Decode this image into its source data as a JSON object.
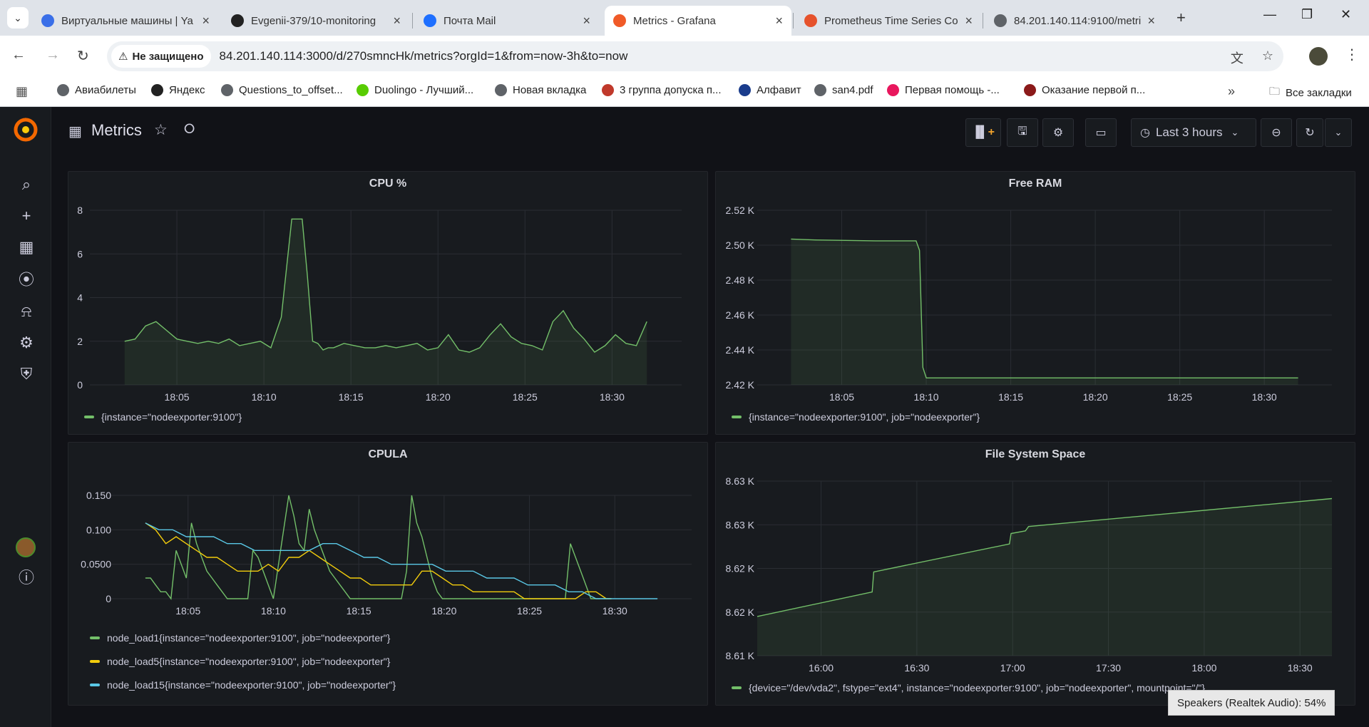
{
  "browser": {
    "tabs": [
      {
        "label": "Виртуальные машины | Ya",
        "icon": "yandex-cloud-icon",
        "color": "#3a6fe8"
      },
      {
        "label": "Evgenii-379/10-monitoring",
        "icon": "github-icon",
        "color": "#222222"
      },
      {
        "label": "Почта Mail",
        "icon": "mail-icon",
        "color": "#1e6fff"
      },
      {
        "label": "Metrics - Grafana",
        "icon": "grafana-icon",
        "color": "#f05a28"
      },
      {
        "label": "Prometheus Time Series Co",
        "icon": "prometheus-icon",
        "color": "#e6522c"
      },
      {
        "label": "84.201.140.114:9100/metri",
        "icon": "globe-icon",
        "color": "#5f6368"
      }
    ],
    "security_label": "Не защищено",
    "url": "84.201.140.114:3000/d/270smncHk/metrics?orgId=1&from=now-3h&to=now",
    "bookmarks": [
      {
        "label": "Авиабилеты",
        "color": "#5f6368"
      },
      {
        "label": "Яндекс",
        "color": "#222222"
      },
      {
        "label": "Questions_to_offset...",
        "color": "#5f6368"
      },
      {
        "label": "Duolingo - Лучший...",
        "color": "#58cc02"
      },
      {
        "label": "Новая вкладка",
        "color": "#5f6368"
      },
      {
        "label": "3 группа допуска п...",
        "color": "#c0392b"
      },
      {
        "label": "Алфавит",
        "color": "#1a3c8c"
      },
      {
        "label": "san4.pdf",
        "color": "#5f6368"
      },
      {
        "label": "Первая помощь -...",
        "color": "#e8175d"
      },
      {
        "label": "Оказание первой п...",
        "color": "#8b1a1a"
      }
    ],
    "all_bookmarks_label": "Все закладки"
  },
  "grafana": {
    "dashboard_title": "Metrics",
    "time_range_label": "Last 3 hours",
    "panels": {
      "cpu": {
        "title": "CPU %",
        "legend": "{instance=\"nodeexporter:9100\"}"
      },
      "ram": {
        "title": "Free RAM",
        "legend": "{instance=\"nodeexporter:9100\", job=\"nodeexporter\"}"
      },
      "cpula": {
        "title": "CPULA",
        "legends": [
          "node_load1{instance=\"nodeexporter:9100\", job=\"nodeexporter\"}",
          "node_load5{instance=\"nodeexporter:9100\", job=\"nodeexporter\"}",
          "node_load15{instance=\"nodeexporter:9100\", job=\"nodeexporter\"}"
        ]
      },
      "fs": {
        "title": "File System Space",
        "legend": "{device=\"/dev/vda2\", fstype=\"ext4\", instance=\"nodeexporter:9100\", job=\"nodeexporter\", mountpoint=\"/\"}"
      }
    }
  },
  "toast": "Speakers (Realtek Audio): 54%",
  "chart_data": [
    {
      "type": "area",
      "title": "CPU %",
      "x_ticks": [
        "18:05",
        "18:10",
        "18:15",
        "18:20",
        "18:25",
        "18:30"
      ],
      "y_ticks": [
        "0",
        "2",
        "4",
        "6",
        "8"
      ],
      "ylim": [
        0,
        8
      ],
      "xlim_minutes": [
        0,
        30
      ],
      "series": [
        {
          "name": "{instance=\"nodeexporter:9100\"}",
          "color": "#73bf69",
          "x": [
            0,
            0.6,
            1.2,
            1.8,
            2.4,
            3.0,
            3.6,
            4.2,
            4.8,
            5.4,
            6.0,
            6.6,
            7.2,
            7.8,
            8.4,
            9.0,
            9.6,
            10.2,
            10.5,
            10.8,
            11.1,
            11.4,
            11.7,
            12.0,
            12.6,
            13.2,
            13.8,
            14.4,
            15.0,
            15.6,
            16.2,
            16.8,
            17.4,
            18.0,
            18.6,
            19.2,
            19.8,
            20.4,
            21.0,
            21.6,
            22.2,
            22.8,
            23.4,
            24.0,
            24.6,
            25.2,
            25.8,
            26.4,
            27.0,
            27.6,
            28.2,
            28.8,
            29.4,
            30.0
          ],
          "y": [
            2.0,
            2.1,
            2.7,
            2.9,
            2.5,
            2.1,
            2.0,
            1.9,
            2.0,
            1.9,
            2.1,
            1.8,
            1.9,
            2.0,
            1.7,
            3.1,
            7.6,
            7.6,
            5.0,
            2.0,
            1.9,
            1.6,
            1.7,
            1.7,
            1.9,
            1.8,
            1.7,
            1.7,
            1.8,
            1.7,
            1.8,
            1.9,
            1.6,
            1.7,
            2.3,
            1.6,
            1.5,
            1.7,
            2.3,
            2.8,
            2.2,
            1.9,
            1.8,
            1.6,
            2.9,
            3.4,
            2.6,
            2.1,
            1.5,
            1.8,
            2.3,
            1.9,
            1.8,
            2.9
          ]
        }
      ]
    },
    {
      "type": "area",
      "title": "Free RAM",
      "x_ticks": [
        "18:05",
        "18:10",
        "18:15",
        "18:20",
        "18:25",
        "18:30"
      ],
      "y_ticks": [
        "2.42 K",
        "2.44 K",
        "2.46 K",
        "2.48 K",
        "2.50 K",
        "2.52 K"
      ],
      "ylim": [
        2420,
        2520
      ],
      "series": [
        {
          "name": "{instance=\"nodeexporter:9100\", job=\"nodeexporter\"}",
          "color": "#73bf69",
          "x": [
            0,
            1.5,
            5,
            7.4,
            7.6,
            7.8,
            8.0,
            30
          ],
          "y": [
            2503.5,
            2503,
            2502.5,
            2502.5,
            2497,
            2430,
            2424,
            2424
          ]
        }
      ]
    },
    {
      "type": "line",
      "title": "CPULA",
      "x_ticks": [
        "18:05",
        "18:10",
        "18:15",
        "18:20",
        "18:25",
        "18:30"
      ],
      "y_ticks": [
        "0",
        "0.0500",
        "0.100",
        "0.150"
      ],
      "ylim": [
        0,
        0.15
      ],
      "series": [
        {
          "name": "node_load1{instance=\"nodeexporter:9100\", job=\"nodeexporter\"}",
          "color": "#73bf69",
          "x": [
            0,
            0.3,
            0.6,
            0.9,
            1.2,
            1.5,
            1.8,
            2.1,
            2.4,
            2.7,
            3.0,
            3.3,
            3.6,
            3.9,
            4.2,
            4.5,
            4.8,
            5.1,
            5.4,
            5.7,
            6.0,
            6.3,
            6.6,
            6.9,
            7.2,
            7.5,
            7.8,
            8.1,
            8.4,
            8.7,
            9.0,
            9.3,
            9.6,
            9.9,
            10.2,
            10.5,
            10.8,
            11.1,
            11.4,
            11.7,
            12.0,
            12.3,
            12.6,
            12.9,
            13.2,
            13.5,
            13.8,
            14.1,
            14.4,
            14.7,
            15.0,
            15.3,
            15.6,
            15.9,
            16.2,
            16.5,
            16.8,
            17.1,
            17.4,
            17.7,
            18.0,
            18.3,
            18.6,
            18.9,
            19.2,
            19.5,
            19.8,
            20.1,
            20.4,
            20.7,
            21.0,
            21.3,
            21.6,
            21.9,
            22.2,
            22.5,
            22.8,
            23.1,
            23.4,
            23.7,
            24.0,
            24.3,
            24.6,
            24.9,
            25.2,
            25.5,
            25.8,
            26.1,
            26.4,
            26.7,
            27.0,
            27.3
          ],
          "y": [
            0.03,
            0.03,
            0.02,
            0.01,
            0.01,
            0.0,
            0.07,
            0.05,
            0.03,
            0.11,
            0.08,
            0.06,
            0.04,
            0.03,
            0.02,
            0.01,
            0.0,
            0.0,
            0.0,
            0.0,
            0.0,
            0.07,
            0.06,
            0.04,
            0.02,
            0.0,
            0.05,
            0.1,
            0.15,
            0.12,
            0.08,
            0.07,
            0.13,
            0.1,
            0.08,
            0.06,
            0.04,
            0.03,
            0.02,
            0.01,
            0.0,
            0.0,
            0.0,
            0.0,
            0.0,
            0.0,
            0.0,
            0.0,
            0.0,
            0.0,
            0.0,
            0.04,
            0.15,
            0.11,
            0.09,
            0.06,
            0.03,
            0.01,
            0.0,
            0.0,
            0.0,
            0.0,
            0.0,
            0.0,
            0.0,
            0.0,
            0.0,
            0.0,
            0.0,
            0.0,
            0.0,
            0.0,
            0.0,
            0.0,
            0.0,
            0.0,
            0.0,
            0.0,
            0.0,
            0.0,
            0.0,
            0.0,
            0.0,
            0.08,
            0.06,
            0.04,
            0.02,
            0.0,
            0.0,
            0.0,
            0.0,
            0.0
          ]
        },
        {
          "name": "node_load5{instance=\"nodeexporter:9100\", job=\"nodeexporter\"}",
          "color": "#f2cc0c",
          "x": [
            0,
            0.6,
            1.2,
            1.8,
            2.4,
            3.0,
            3.6,
            4.2,
            4.8,
            5.4,
            6.0,
            6.6,
            7.2,
            7.8,
            8.4,
            9.0,
            9.6,
            10.2,
            10.8,
            11.4,
            12.0,
            12.6,
            13.2,
            13.8,
            14.4,
            15.0,
            15.6,
            16.2,
            16.8,
            17.4,
            18.0,
            18.6,
            19.2,
            19.8,
            20.4,
            21.0,
            21.6,
            22.2,
            22.8,
            23.4,
            24.0,
            24.6,
            25.2,
            25.8,
            26.4,
            27.0,
            27.3
          ],
          "y": [
            0.11,
            0.1,
            0.08,
            0.09,
            0.08,
            0.07,
            0.06,
            0.06,
            0.05,
            0.04,
            0.04,
            0.04,
            0.05,
            0.04,
            0.06,
            0.06,
            0.07,
            0.06,
            0.05,
            0.04,
            0.03,
            0.03,
            0.02,
            0.02,
            0.02,
            0.02,
            0.02,
            0.04,
            0.04,
            0.03,
            0.02,
            0.02,
            0.01,
            0.01,
            0.01,
            0.01,
            0.01,
            0.0,
            0.0,
            0.0,
            0.0,
            0.0,
            0.0,
            0.01,
            0.01,
            0.0,
            0.0
          ]
        },
        {
          "name": "node_load15{instance=\"nodeexporter:9100\", job=\"nodeexporter\"}",
          "color": "#5ac8e6",
          "x": [
            0,
            0.8,
            1.6,
            2.4,
            3.2,
            4.0,
            4.8,
            5.6,
            6.4,
            7.2,
            8.0,
            8.8,
            9.6,
            10.4,
            11.2,
            12.0,
            12.8,
            13.6,
            14.4,
            15.2,
            16.0,
            16.8,
            17.6,
            18.4,
            19.2,
            20.0,
            20.8,
            21.6,
            22.4,
            23.2,
            24.0,
            24.8,
            25.6,
            26.4,
            27.2,
            28.0,
            28.8,
            29.6,
            30.0
          ],
          "y": [
            0.11,
            0.1,
            0.1,
            0.09,
            0.09,
            0.09,
            0.08,
            0.08,
            0.07,
            0.07,
            0.07,
            0.07,
            0.07,
            0.08,
            0.08,
            0.07,
            0.06,
            0.06,
            0.05,
            0.05,
            0.05,
            0.05,
            0.04,
            0.04,
            0.04,
            0.03,
            0.03,
            0.03,
            0.02,
            0.02,
            0.02,
            0.01,
            0.01,
            0.0,
            0.0,
            0.0,
            0.0,
            0.0,
            0.0
          ]
        }
      ]
    },
    {
      "type": "area",
      "title": "File System Space",
      "x_ticks": [
        "16:00",
        "16:30",
        "17:00",
        "17:30",
        "18:00",
        "18:30"
      ],
      "y_ticks": [
        "8.61 K",
        "8.62 K",
        "8.62 K",
        "8.63 K",
        "8.63 K"
      ],
      "ylim": [
        8613,
        8633
      ],
      "series": [
        {
          "name": "{device=\"/dev/vda2\", fstype=\"ext4\", instance=\"nodeexporter:9100\", job=\"nodeexporter\", mountpoint=\"/\"}",
          "color": "#73bf69",
          "x": [
            0,
            36,
            36.5,
            79,
            79.5,
            84,
            85,
            180
          ],
          "y": [
            8617.5,
            8620.3,
            8622.6,
            8625.8,
            8627.0,
            8627.3,
            8627.8,
            8631.0
          ]
        }
      ]
    }
  ]
}
